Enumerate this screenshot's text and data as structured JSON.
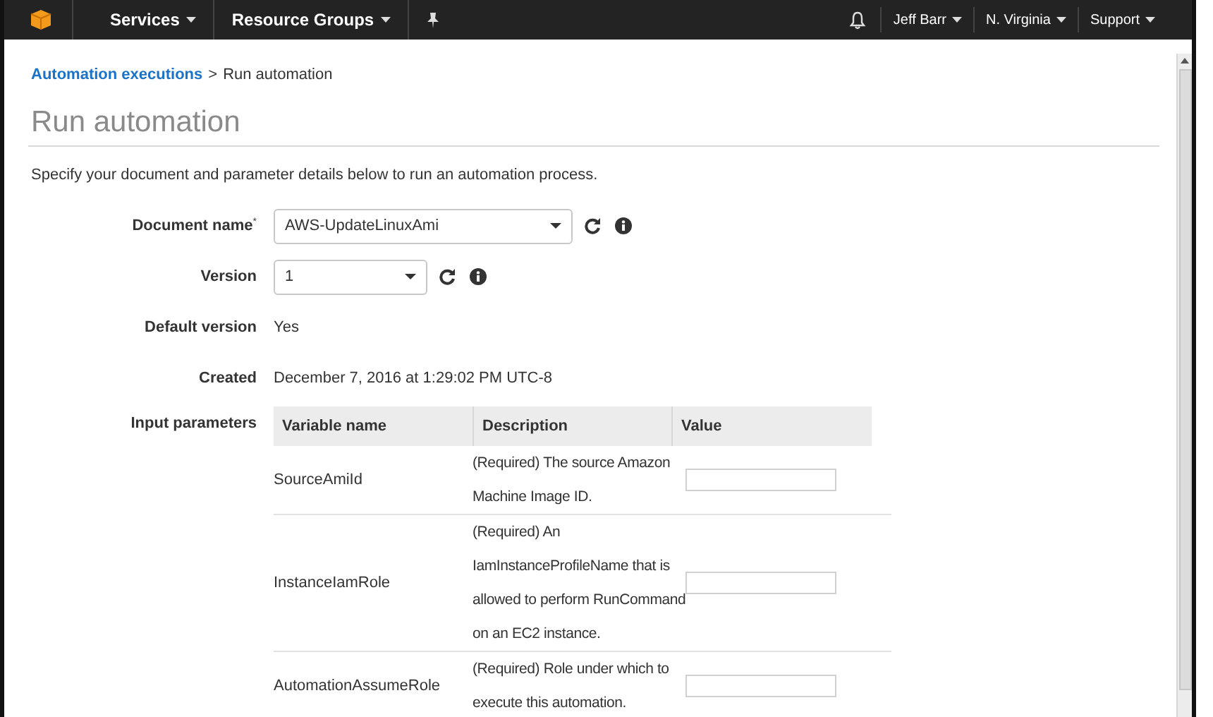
{
  "nav": {
    "menus": [
      {
        "label": "Services"
      },
      {
        "label": "Resource Groups"
      }
    ],
    "user": "Jeff Barr",
    "region": "N. Virginia",
    "support": "Support"
  },
  "breadcrumb": {
    "link": "Automation executions",
    "separator": ">",
    "current": "Run automation"
  },
  "title": "Run automation",
  "intro": "Specify your document and parameter details below to run an automation process.",
  "fields": [
    {
      "kind": "select",
      "label": "Document name",
      "marker": "*",
      "value": "AWS-UpdateLinuxAmi",
      "wide": true
    },
    {
      "kind": "select",
      "label": "Version",
      "value": "1",
      "wide": false
    },
    {
      "kind": "text",
      "label": "Default version",
      "value": "Yes"
    },
    {
      "kind": "text",
      "label": "Created",
      "value": "December 7, 2016 at 1:29:02 PM UTC-8"
    },
    {
      "kind": "table",
      "label": "Input parameters"
    }
  ],
  "parameters": {
    "columns": [
      "Variable name",
      "Description",
      "Value"
    ],
    "rows": [
      {
        "name": "SourceAmiId",
        "description": [
          "(Required) The source Amazon",
          "Machine Image ID."
        ]
      },
      {
        "name": "InstanceIamRole",
        "description": [
          "(Required) An",
          "IamInstanceProfileName that is",
          "allowed to perform RunCommand",
          "on an EC2 instance."
        ]
      },
      {
        "name": "AutomationAssumeRole",
        "description": [
          "(Required) Role under which to",
          "execute this automation."
        ]
      }
    ]
  }
}
